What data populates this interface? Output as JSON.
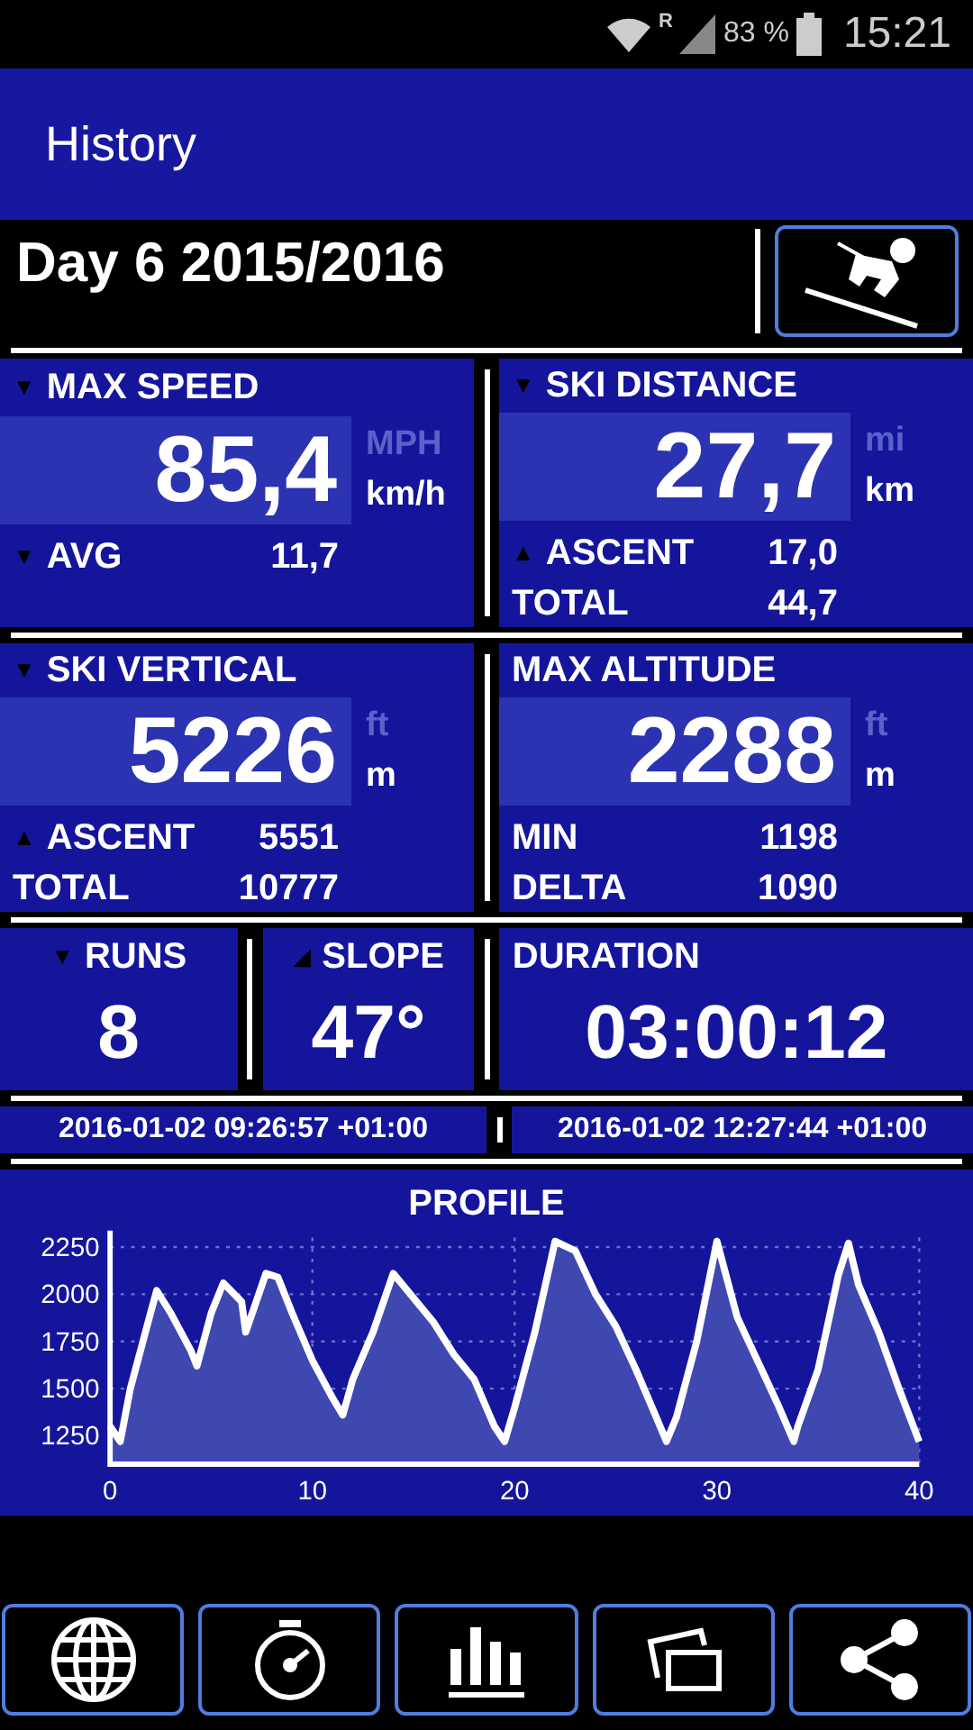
{
  "status_bar": {
    "network": "R",
    "battery": "83 %",
    "time": "15:21"
  },
  "app_bar": {
    "title": "History"
  },
  "header": {
    "title": "Day 6 2015/2016"
  },
  "stats": [
    {
      "marker": "▼",
      "title": "MAX SPEED",
      "value": "85,4",
      "units": [
        {
          "label": "MPH",
          "selected": false
        },
        {
          "label": "km/h",
          "selected": true
        }
      ],
      "rows": [
        {
          "marker": "▼",
          "label": "AVG",
          "value": "11,7"
        }
      ]
    },
    {
      "marker": "▼",
      "title": "SKI DISTANCE",
      "value": "27,7",
      "units": [
        {
          "label": "mi",
          "selected": false
        },
        {
          "label": "km",
          "selected": true
        }
      ],
      "rows": [
        {
          "marker": "▲",
          "label": "ASCENT",
          "value": "17,0"
        },
        {
          "label": "TOTAL",
          "value": "44,7"
        }
      ]
    },
    {
      "marker": "▼",
      "title": "SKI VERTICAL",
      "value": "5226",
      "units": [
        {
          "label": "ft",
          "selected": false
        },
        {
          "label": "m",
          "selected": true
        }
      ],
      "rows": [
        {
          "marker": "▲",
          "label": "ASCENT",
          "value": "5551"
        },
        {
          "label": "TOTAL",
          "value": "10777"
        }
      ]
    },
    {
      "title": "MAX ALTITUDE",
      "value": "2288",
      "units": [
        {
          "label": "ft",
          "selected": false
        },
        {
          "label": "m",
          "selected": true
        }
      ],
      "rows": [
        {
          "label": "MIN",
          "value": "1198"
        },
        {
          "label": "DELTA",
          "value": "1090"
        }
      ]
    }
  ],
  "summary": [
    {
      "marker": "▼",
      "title": "RUNS",
      "value": "8"
    },
    {
      "marker": "◢",
      "title": "SLOPE",
      "value": "47°"
    },
    {
      "title": "DURATION",
      "value": "03:00:12"
    }
  ],
  "times": [
    "2016-01-02 09:26:57 +01:00",
    "2016-01-02 12:27:44 +01:00"
  ],
  "profile": {
    "chart_data": {
      "type": "area",
      "title": "PROFILE",
      "x": [
        0,
        0.5,
        1,
        2,
        2.3,
        3,
        4,
        4.3,
        5,
        5.6,
        6.5,
        6.7,
        7.7,
        8.3,
        9,
        10,
        11,
        11.5,
        12,
        13,
        14,
        15,
        16,
        17,
        18,
        19,
        19.5,
        20,
        21,
        22,
        23,
        24,
        25,
        26,
        27,
        27.5,
        28,
        29,
        30,
        31,
        32,
        33,
        33.8,
        34,
        35,
        36,
        36.5,
        37,
        38,
        39,
        40
      ],
      "grid": true,
      "series": [
        {
          "color": "#ffffff",
          "values": [
            1300,
            1220,
            1500,
            1900,
            2020,
            1900,
            1700,
            1620,
            1900,
            2060,
            1960,
            1800,
            2110,
            2090,
            1900,
            1650,
            1450,
            1360,
            1550,
            1800,
            2110,
            1980,
            1850,
            1680,
            1550,
            1300,
            1220,
            1400,
            1800,
            2280,
            2230,
            2000,
            1830,
            1600,
            1350,
            1220,
            1350,
            1750,
            2280,
            1880,
            1650,
            1420,
            1220,
            1300,
            1600,
            2100,
            2270,
            2050,
            1800,
            1500,
            1220
          ]
        }
      ],
      "xlim": [
        0,
        40
      ],
      "ylim": [
        1100,
        2300
      ],
      "xticks": [
        0,
        10,
        20,
        30,
        40
      ],
      "yticks": [
        1250,
        1500,
        1750,
        2000,
        2250
      ]
    }
  },
  "nav_buttons": [
    {
      "kind": "globe"
    },
    {
      "kind": "stopwatch"
    },
    {
      "kind": "bars"
    },
    {
      "kind": "photos"
    },
    {
      "kind": "share"
    }
  ]
}
